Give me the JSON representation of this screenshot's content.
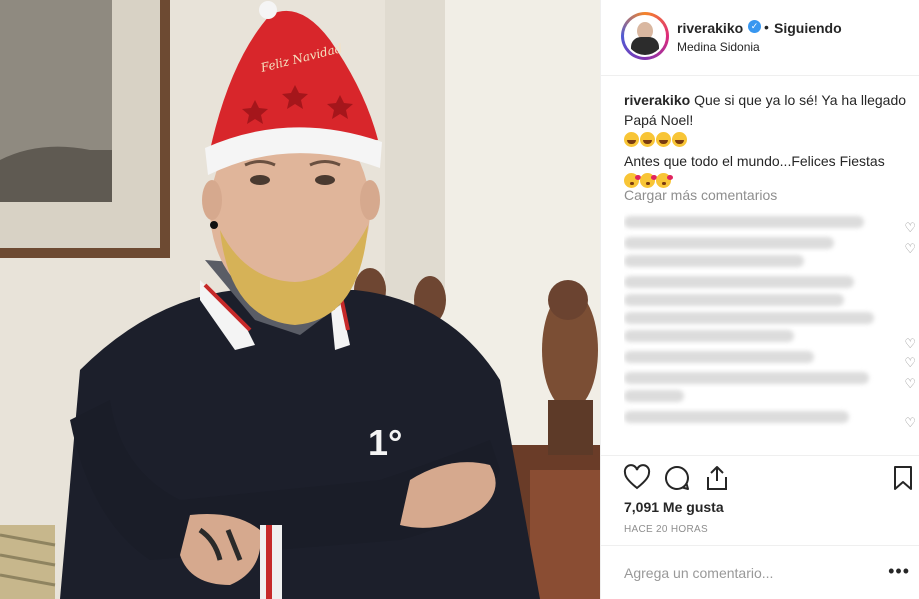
{
  "post": {
    "username": "riverakiko",
    "verified_icon": "verified-badge-icon",
    "separator": "•",
    "follow_status": "Siguiendo",
    "location": "Medina Sidonia"
  },
  "caption": {
    "username": "riverakiko",
    "line1": "Que si que ya lo sé! Ya ha llegado Papá Noel!",
    "line1_emoji": "😂😂😂😂",
    "line2": "Antes que todo el mundo...Felices Fiestas",
    "line2_emoji": "😘😘😘"
  },
  "comments": {
    "load_more": "Cargar más comentarios"
  },
  "actions": {
    "like_icon": "heart-icon",
    "comment_icon": "comment-icon",
    "share_icon": "share-icon",
    "save_icon": "bookmark-icon",
    "likes": "7,091 Me gusta",
    "time_ago": "HACE 20 HORAS"
  },
  "add_comment": {
    "placeholder": "Agrega un comentario...",
    "more": "•••"
  },
  "photo": {
    "hat_text": "Feliz Navidad",
    "sweater_text": "1°"
  }
}
